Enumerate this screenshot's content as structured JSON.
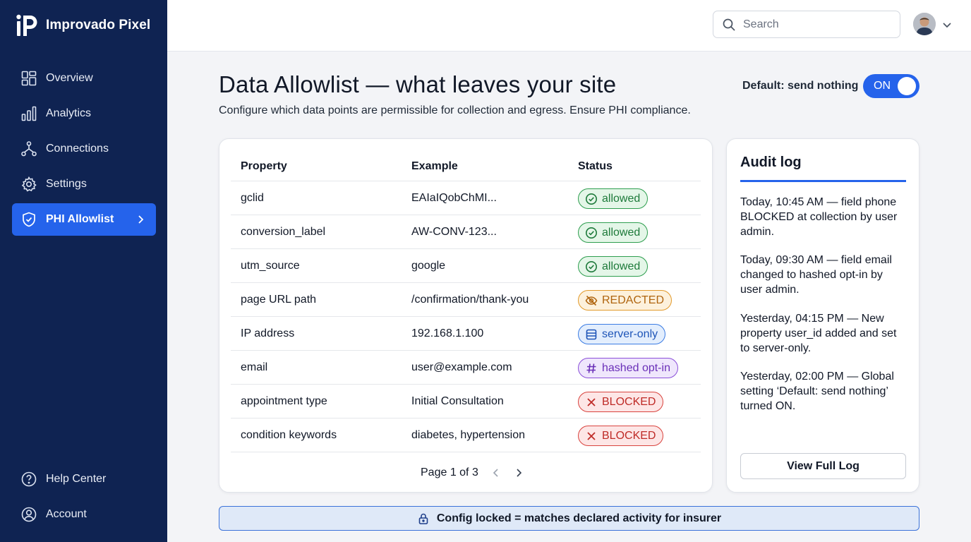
{
  "app": {
    "name": "Improvado Pixel",
    "logo_text": "iP"
  },
  "sidebar": {
    "items": [
      {
        "label": "Overview",
        "icon": "dashboard-icon"
      },
      {
        "label": "Analytics",
        "icon": "bar-chart-icon"
      },
      {
        "label": "Connections",
        "icon": "network-icon"
      },
      {
        "label": "Settings",
        "icon": "gear-icon"
      },
      {
        "label": "PHI Allowlist",
        "icon": "shield-icon",
        "active": true
      }
    ],
    "bottom_items": [
      {
        "label": "Help Center",
        "icon": "help-icon"
      },
      {
        "label": "Account",
        "icon": "user-icon"
      }
    ]
  },
  "topbar": {
    "search_placeholder": "Search"
  },
  "header": {
    "title": "Data Allowlist — what leaves your site",
    "subtitle": "Configure which data points are permissible for collection and egress. Ensure PHI compliance.",
    "toggle_label": "Default: send nothing",
    "toggle_state": "ON"
  },
  "table": {
    "columns": [
      "Property",
      "Example",
      "Status"
    ],
    "rows": [
      {
        "property": "gclid",
        "example": "EAIaIQobChMI...",
        "status": "allowed",
        "kind": "green"
      },
      {
        "property": "conversion_label",
        "example": "AW-CONV-123...",
        "status": "allowed",
        "kind": "green"
      },
      {
        "property": "utm_source",
        "example": "google",
        "status": "allowed",
        "kind": "green"
      },
      {
        "property": "page URL path",
        "example": "/confirmation/thank-you",
        "status": "REDACTED",
        "kind": "orange"
      },
      {
        "property": "IP address",
        "example": "192.168.1.100",
        "status": "server-only",
        "kind": "blue"
      },
      {
        "property": "email",
        "example": "user@example.com",
        "status": "hashed opt-in",
        "kind": "purple"
      },
      {
        "property": "appointment type",
        "example": "Initial Consultation",
        "status": "BLOCKED",
        "kind": "red"
      },
      {
        "property": "condition keywords",
        "example": "diabetes, hypertension",
        "status": "BLOCKED",
        "kind": "red"
      }
    ],
    "pagination": "Page 1 of 3"
  },
  "audit": {
    "title": "Audit log",
    "entries": [
      "Today, 10:45 AM — field phone BLOCKED at collection by user admin.",
      "Today, 09:30 AM — field email changed to hashed opt-in by user admin.",
      "Yesterday, 04:15 PM — New property user_id added and set to server-only.",
      "Yesterday, 02:00 PM — Global setting ‘Default: send nothing’ turned ON."
    ],
    "button_label": "View Full Log"
  },
  "lockbar": {
    "text": "Config locked = matches declared activity for insurer"
  },
  "colors": {
    "sidebar_bg": "#0f2352",
    "accent": "#2563eb",
    "allowed": "#2e9e4f",
    "redacted": "#e29a2b",
    "server_only": "#3b7ce3",
    "hashed": "#8b4fd9",
    "blocked": "#d9443f"
  }
}
